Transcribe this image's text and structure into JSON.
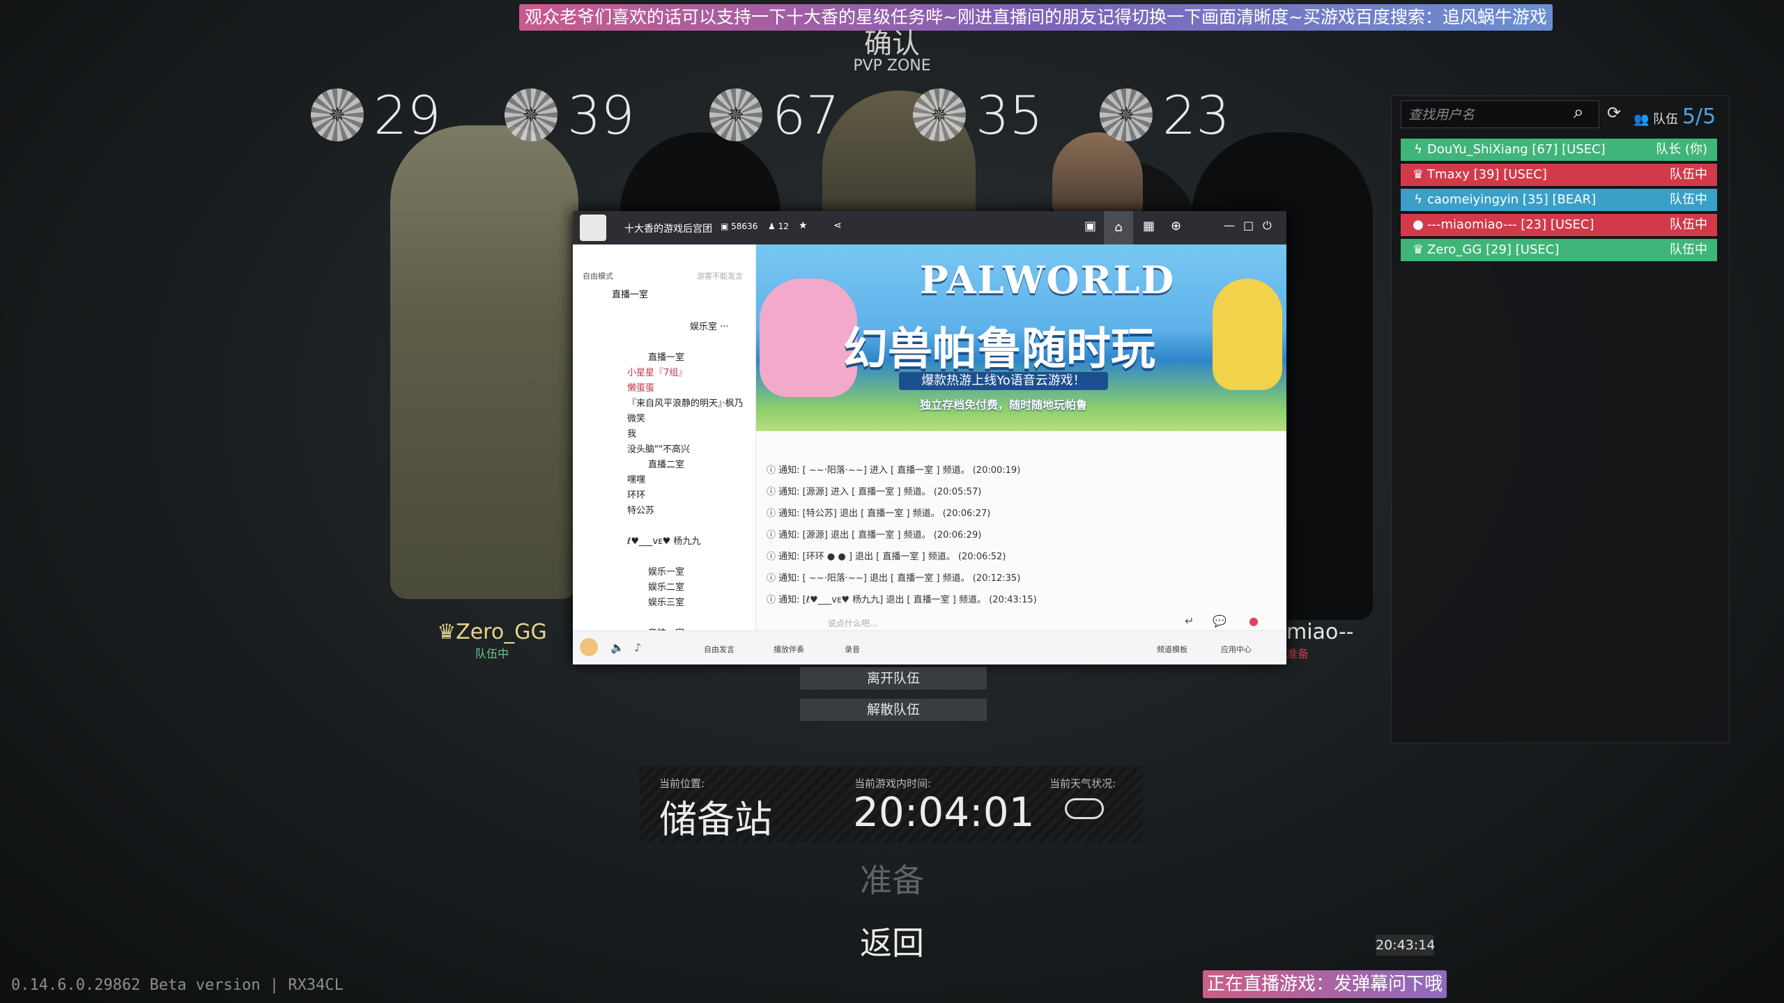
{
  "banner": "观众老爷们喜欢的话可以支持一下十大香的星级任务哔~刚进直播间的朋友记得切换一下画面清晰度~买游戏百度搜索：追风蜗牛游戏",
  "zone": {
    "title": "确认",
    "subtitle": "PVP ZONE"
  },
  "levels": [
    "29",
    "39",
    "67",
    "35",
    "23"
  ],
  "players_left": {
    "name": "Zero_GG",
    "status": "队伍中"
  },
  "players_right": {
    "name": "miao--",
    "status": "准备"
  },
  "squad_panel": {
    "search_placeholder": "查找用户名",
    "squad_label": "队伍",
    "squad_count": "5/5",
    "members": [
      {
        "name": "DouYu_ShiXiang",
        "level": "[67]",
        "faction": "[USEC]",
        "status": "队长 (你)",
        "color": "#3fb57a"
      },
      {
        "name": "Tmaxy",
        "level": "[39]",
        "faction": "[USEC]",
        "status": "队伍中",
        "color": "#d23a4a"
      },
      {
        "name": "caomeiyingyin",
        "level": "[35]",
        "faction": "[BEAR]",
        "status": "队伍中",
        "color": "#3aa0c8"
      },
      {
        "name": "---miaomiao---",
        "level": "[23]",
        "faction": "[USEC]",
        "status": "队伍中",
        "color": "#d23a4a"
      },
      {
        "name": "Zero_GG",
        "level": "[29]",
        "faction": "[USEC]",
        "status": "队伍中",
        "color": "#3fb57a"
      }
    ]
  },
  "overlay": {
    "room_name": "十大香的游戏后宫团",
    "room_id": "58636",
    "online": "12",
    "mode": "自由模式",
    "mode_hint": "游客不能发言",
    "channel_current": "直播一室",
    "tree": [
      "娱乐室 ···",
      "直播一室",
      "小星星『7组』",
      "懒蛋蛋",
      "『来自风平浪静的明天』·枫乃",
      "微笑",
      "我",
      "没头脑\"\"不高兴",
      "直播二室",
      "嘿嘿",
      "环环",
      "特公苏",
      "ℓ♥___ᴠᴇ♥ 杨九九",
      "娱乐一室",
      "娱乐二室",
      "娱乐三室",
      "竞技一室"
    ],
    "banner_title": "PALWORLD",
    "banner_cn": "幻兽帕鲁随时玩",
    "banner_sub1": "爆款热游上线Yo语音云游戏！",
    "banner_sub2": "独立存档免付费，随时随地玩帕鲁",
    "messages": [
      {
        "label": "通知:",
        "text": "[ ~~·阳落·~~] 进入 [  直播一室  ] 频道。",
        "time": "(20:00:19)"
      },
      {
        "label": "通知:",
        "text": "[源源] 进入 [  直播一室  ] 频道。",
        "time": "(20:05:57)"
      },
      {
        "label": "通知:",
        "text": "[特公苏] 退出 [  直播一室  ] 频道。",
        "time": "(20:06:27)"
      },
      {
        "label": "通知:",
        "text": "[源源] 退出 [  直播一室  ] 频道。",
        "time": "(20:06:29)"
      },
      {
        "label": "通知:",
        "text": "[环环 ● ● ] 退出 [  直播一室  ] 频道。",
        "time": "(20:06:52)"
      },
      {
        "label": "通知:",
        "text": "[ ~~·阳落·~~] 退出 [  直播一室  ] 频道。",
        "time": "(20:12:35)"
      },
      {
        "label": "通知:",
        "text": "[ℓ♥___ᴠᴇ♥ 杨九九] 退出 [  直播一室  ] 频道。",
        "time": "(20:43:15)"
      }
    ],
    "input_placeholder": "说点什么吧...",
    "bottom": {
      "free": "自由发言",
      "music": "播放伴奏",
      "record": "录音",
      "effects": "频道模板",
      "apps": "应用中心"
    }
  },
  "buttons": {
    "leave": "离开队伍",
    "disband": "解散队伍"
  },
  "info": {
    "location_label": "当前位置:",
    "location": "储备站",
    "time_label": "当前游戏内时间:",
    "time": "20:04:01",
    "weather_label": "当前天气状况:"
  },
  "actions": {
    "ready": "准备",
    "back": "返回"
  },
  "version": "0.14.6.0.29862 Beta version | RX34CL",
  "clock": "20:43:14",
  "live_tag": "正在直播游戏：发弹幕问下哦"
}
